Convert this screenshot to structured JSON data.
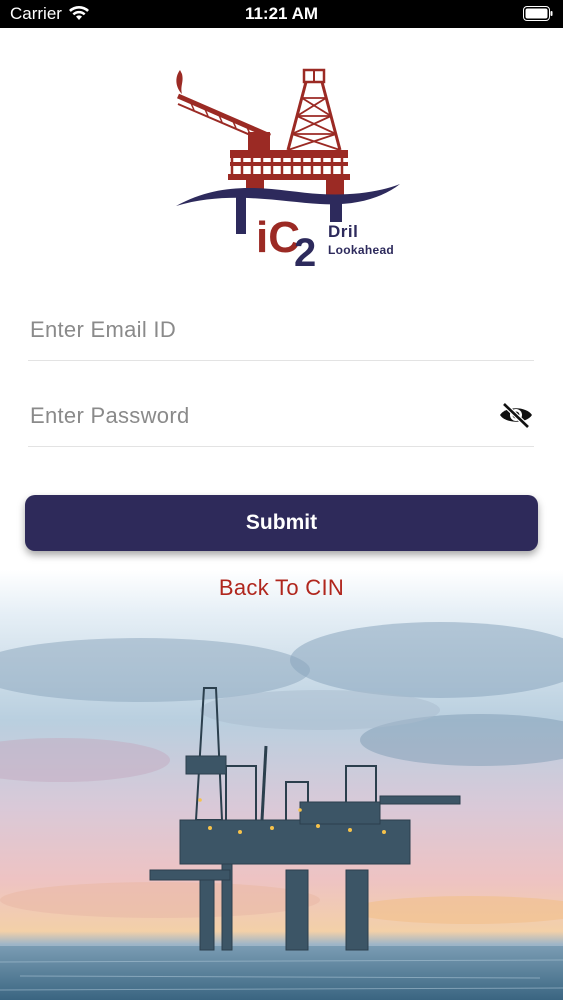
{
  "status_bar": {
    "carrier": "Carrier",
    "time": "11:21 AM"
  },
  "logo": {
    "mark": "iC",
    "superscript": "2",
    "line1": "Dril",
    "line2": "Lookahead",
    "colors": {
      "navy": "#2d2a5c",
      "red": "#9b2a24"
    }
  },
  "form": {
    "email_placeholder": "Enter Email ID",
    "email_value": "",
    "password_placeholder": "Enter Password",
    "password_value": "",
    "submit_label": "Submit",
    "back_label": "Back To CIN",
    "eye_icon": "eye-slash-icon"
  },
  "theme": {
    "primary": "#2e2a5a",
    "link": "#b0261d"
  }
}
